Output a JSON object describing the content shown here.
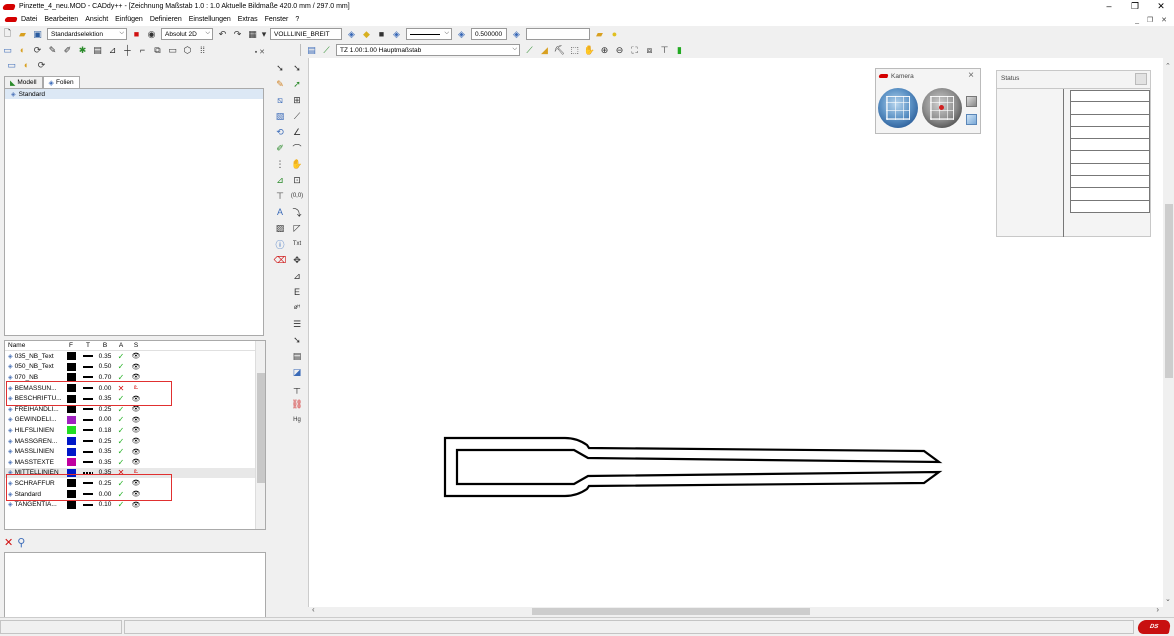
{
  "window": {
    "title": "Pinzette_4_neu.MOD  -  CADdy++ - [Zeichnung   Maßstab 1.0 : 1.0   Aktuelle Bildmaße 420.0 mm / 297.0 mm]",
    "btn_minimize": "–",
    "btn_maximize": "❐",
    "btn_close": "✕",
    "mdi_controls": "_ ❐ ✕"
  },
  "menu": {
    "items": [
      "Datei",
      "Bearbeiten",
      "Ansicht",
      "Einfügen",
      "Definieren",
      "Einstellungen",
      "Extras",
      "Fenster",
      "?"
    ]
  },
  "toolbar": {
    "selection_mode": "Standardselektion",
    "coord_mode": "Absolut 2D",
    "line_type": "VOLLLINIE_BREIT",
    "line_width": "0.500000",
    "scale_combo": "TZ 1.00:1.00 Hauptmaßstab"
  },
  "left_panel": {
    "tabs": [
      "Modell",
      "Folien"
    ],
    "active_tab": "Folien",
    "tree_items": [
      "Standard"
    ]
  },
  "layers": {
    "columns": [
      "Name",
      "F",
      "T",
      "B",
      "A",
      "S"
    ],
    "rows": [
      {
        "name": "035_NB_Text",
        "color": "#000000",
        "line": "solid",
        "width": "0.35",
        "active": true,
        "visible": true
      },
      {
        "name": "050_NB_Text",
        "color": "#000000",
        "line": "solid",
        "width": "0.50",
        "active": true,
        "visible": true
      },
      {
        "name": "070_NB",
        "color": "#000000",
        "line": "solid",
        "width": "0.70",
        "active": true,
        "visible": true
      },
      {
        "name": "BEMASSUN...",
        "color": "#000000",
        "line": "solid",
        "width": "0.00",
        "active": false,
        "visible": false
      },
      {
        "name": "BESCHRIFTU...",
        "color": "#000000",
        "line": "solid",
        "width": "0.35",
        "active": true,
        "visible": true
      },
      {
        "name": "FREIHANDLI...",
        "color": "#000000",
        "line": "solid",
        "width": "0.25",
        "active": true,
        "visible": true
      },
      {
        "name": "GEWINDELI...",
        "color": "#a020c0",
        "line": "solid",
        "width": "0.00",
        "active": true,
        "visible": true
      },
      {
        "name": "HILFSLINIEN",
        "color": "#22dd22",
        "line": "solid",
        "width": "0.18",
        "active": true,
        "visible": true
      },
      {
        "name": "MASSGREN...",
        "color": "#0018c8",
        "line": "solid",
        "width": "0.25",
        "active": true,
        "visible": true
      },
      {
        "name": "MASSLINIEN",
        "color": "#0018c8",
        "line": "solid",
        "width": "0.35",
        "active": true,
        "visible": true
      },
      {
        "name": "MASSTEXTE",
        "color": "#c000a0",
        "line": "solid",
        "width": "0.35",
        "active": true,
        "visible": true
      },
      {
        "name": "MITTELLINIEN",
        "color": "#0018c8",
        "line": "dashdot",
        "width": "0.35",
        "active": false,
        "visible": false
      },
      {
        "name": "SCHRAFFUR",
        "color": "#000000",
        "line": "solid",
        "width": "0.25",
        "active": true,
        "visible": true
      },
      {
        "name": "Standard",
        "color": "#000000",
        "line": "solid",
        "width": "0.00",
        "active": true,
        "visible": true
      },
      {
        "name": "TANGENTIA...",
        "color": "#000000",
        "line": "solid",
        "width": "0.10",
        "active": true,
        "visible": true
      }
    ]
  },
  "camera_window": {
    "title": "Kamera"
  },
  "status_window": {
    "title": "Status"
  },
  "icons": {
    "check": "✓",
    "cross": "✕",
    "eye": "👁",
    "eye_off": "ఽ"
  },
  "brand": {
    "logo_text": "Data Solid"
  },
  "colors": {
    "accent_red": "#d40000",
    "ok_green": "#22b022",
    "highlight_box": "#e03030"
  }
}
